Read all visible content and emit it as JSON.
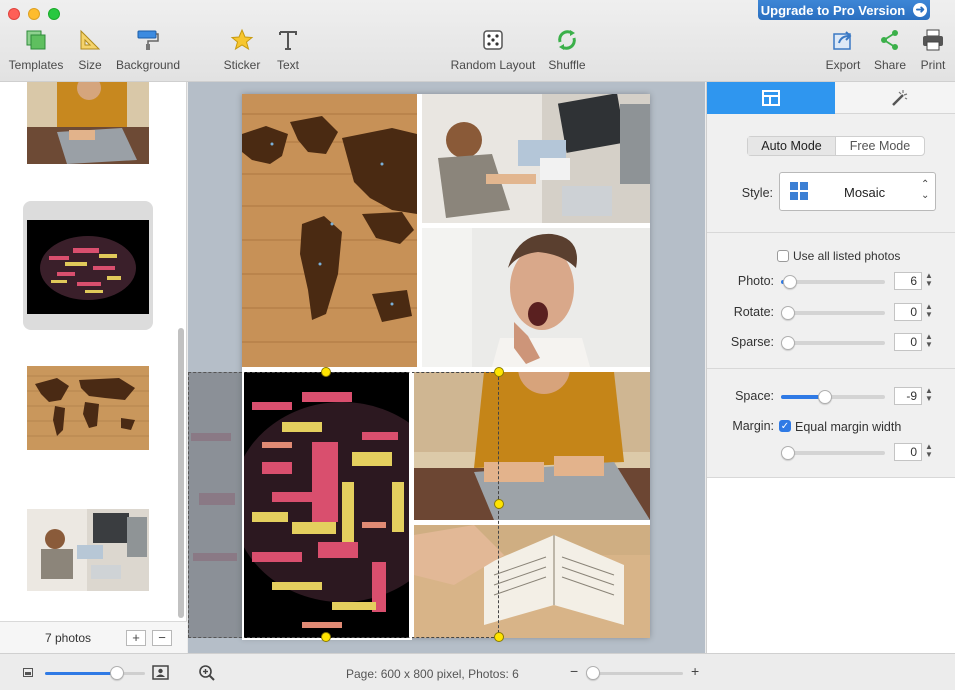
{
  "window": {
    "upgrade_label": "Upgrade to Pro Version"
  },
  "toolbar": {
    "templates": "Templates",
    "size": "Size",
    "background": "Background",
    "sticker": "Sticker",
    "text": "Text",
    "random_layout": "Random Layout",
    "shuffle": "Shuffle",
    "export": "Export",
    "share": "Share",
    "print": "Print"
  },
  "sidebar": {
    "photo_count": "7 photos",
    "add_label": "+",
    "remove_label": "−",
    "thumbnails": [
      "typing-laptop-photo",
      "word-cloud-brain-photo",
      "wooden-world-map-photo",
      "office-desk-photo"
    ]
  },
  "panel": {
    "mode_auto": "Auto Mode",
    "mode_free": "Free Mode",
    "style_label": "Style:",
    "style_value": "Mosaic",
    "use_all_label": "Use all listed photos",
    "use_all_checked": false,
    "photo_label": "Photo:",
    "photo_value": "6",
    "rotate_label": "Rotate:",
    "rotate_value": "0",
    "sparse_label": "Sparse:",
    "sparse_value": "0",
    "space_label": "Space:",
    "space_value": "-9",
    "margin_label": "Margin:",
    "equal_margin_label": "Equal margin width",
    "equal_margin_checked": true,
    "margin_value": "0"
  },
  "status": {
    "info": "Page: 600 x 800 pixel, Photos: 6",
    "minus": "−",
    "plus": "+"
  },
  "colors": {
    "accent": "#2f7ae5",
    "handle": "#ffe400"
  }
}
